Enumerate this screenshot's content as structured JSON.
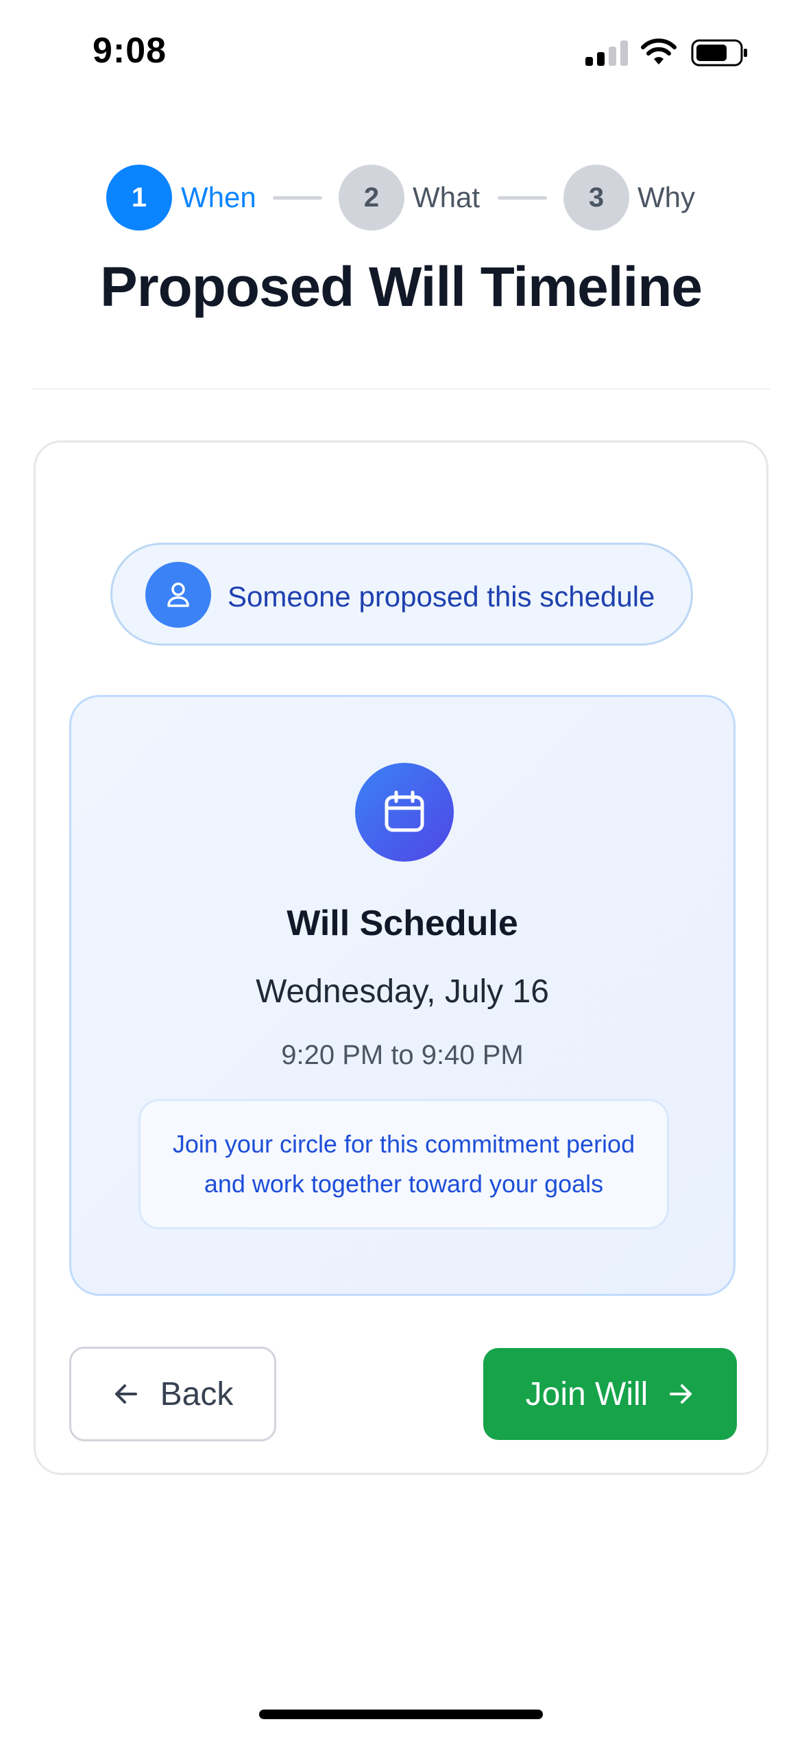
{
  "status_bar": {
    "time": "9:08"
  },
  "stepper": {
    "steps": [
      {
        "number": "1",
        "label": "When",
        "state": "active"
      },
      {
        "number": "2",
        "label": "What",
        "state": "inactive"
      },
      {
        "number": "3",
        "label": "Why",
        "state": "inactive"
      }
    ]
  },
  "page": {
    "title": "Proposed Will Timeline"
  },
  "proposal": {
    "text": "Someone proposed this schedule"
  },
  "schedule": {
    "title": "Will Schedule",
    "date": "Wednesday, July 16",
    "time_range": "9:20 PM to 9:40 PM",
    "note_line1": "Join your circle for this commitment period",
    "note_line2": "and work together toward your goals"
  },
  "actions": {
    "back_label": "Back",
    "join_label": "Join Will"
  },
  "icons": {
    "person": "person-icon",
    "calendar": "calendar-icon",
    "back": "arrow-left-icon",
    "forward": "arrow-right-icon"
  },
  "colors": {
    "active_step": "#0a84ff",
    "join_button": "#16a34a",
    "proposal_text": "#1e40af",
    "calendar_gradient_start": "#3b82f6",
    "calendar_gradient_end": "#4f46e5"
  }
}
